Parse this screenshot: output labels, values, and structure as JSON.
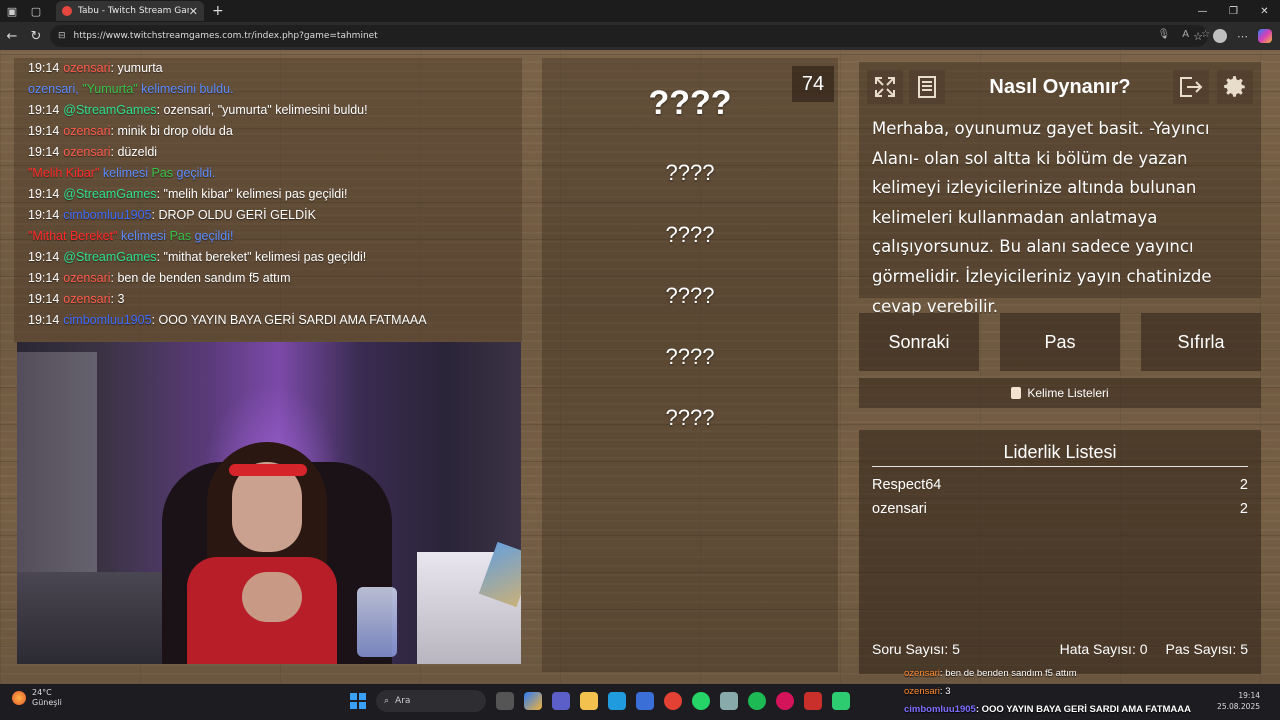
{
  "browser": {
    "tab_title": "Tabu - Twitch Stream Games",
    "url": "https://www.twitchstreamgames.com.tr/index.php?game=tahminet"
  },
  "chat": {
    "lines": [
      {
        "time": "19:14",
        "user": "ozensari",
        "msg": ": yumurta"
      },
      {
        "sys_user": "ozensari,",
        "word": "\"Yumurta\"",
        "rest": " kelimesini buldu."
      },
      {
        "time": "19:14",
        "user": "@StreamGames",
        "msg": ": ozensari, \"yumurta\" kelimesini buldu!"
      },
      {
        "time": "19:14",
        "user": "ozensari",
        "msg": ": minik bi drop oldu da"
      },
      {
        "time": "19:14",
        "user": "ozensari",
        "msg": ": düzeldi"
      },
      {
        "word": "\"Melih Kibar\"",
        "rest1": " kelimesi ",
        "pas": "Pas",
        "rest2": " geçildi."
      },
      {
        "time": "19:14",
        "user": "@StreamGames",
        "msg": ": \"melih kibar\" kelimesi pas geçildi!"
      },
      {
        "time": "19:14",
        "user": "cimbomluu1905",
        "msg": ": DROP OLDU GERİ GELDİK"
      },
      {
        "word": "\"Mithat Bereket\"",
        "rest1": " kelimesi ",
        "pas": "Pas",
        "rest2": " geçildi!"
      },
      {
        "time": "19:14",
        "user": "@StreamGames",
        "msg": ": \"mithat bereket\" kelimesi pas geçildi!"
      },
      {
        "time": "19:14",
        "user": "ozensari",
        "msg": ": ben de benden sandım f5 attım"
      },
      {
        "time": "19:14",
        "user": "ozensari",
        "msg": ": 3"
      },
      {
        "time": "19:14",
        "user": "cimbomluu1905",
        "msg": ": OOO YAYIN BAYA GERİ SARDI AMA FATMAAA"
      }
    ]
  },
  "game": {
    "counter": "74",
    "words": [
      "????",
      "????",
      "????",
      "????",
      "????",
      "????"
    ]
  },
  "howto": {
    "title": "Nasıl Oynanır?",
    "text": "Merhaba, oyunumuz gayet basit. -Yayıncı Alanı- olan sol altta ki bölüm de yazan kelimeyi izleyicilerinize altında bulunan kelimeleri kullanmadan anlatmaya çalışıyorsunuz. Bu alanı sadece yayıncı görmelidir. İzleyicileriniz yayın chatinizde cevap verebilir."
  },
  "buttons": {
    "next": "Sonraki",
    "pass": "Pas",
    "reset": "Sıfırla",
    "word_lists": "Kelime Listeleri"
  },
  "leaderboard": {
    "title": "Liderlik Listesi",
    "rows": [
      {
        "name": "Respect64",
        "score": "2"
      },
      {
        "name": "ozensari",
        "score": "2"
      }
    ],
    "stats": {
      "questions": "Soru Sayısı: 5",
      "errors": "Hata Sayısı: 0",
      "passes": "Pas Sayısı: 5"
    }
  },
  "overlay": [
    {
      "user": "ozensari",
      "msg": ": ben de benden sandım f5 attım"
    },
    {
      "user": "ozensari",
      "msg": ": 3"
    },
    {
      "user": "cimbomluu1905",
      "msg": ": OOO YAYIN BAYA GERİ SARDI AMA FATMAAA"
    }
  ],
  "taskbar": {
    "weather_temp": "24°C",
    "weather_desc": "Güneşli",
    "search": "Ara",
    "time": "19:14",
    "date": "25.08.2025"
  }
}
